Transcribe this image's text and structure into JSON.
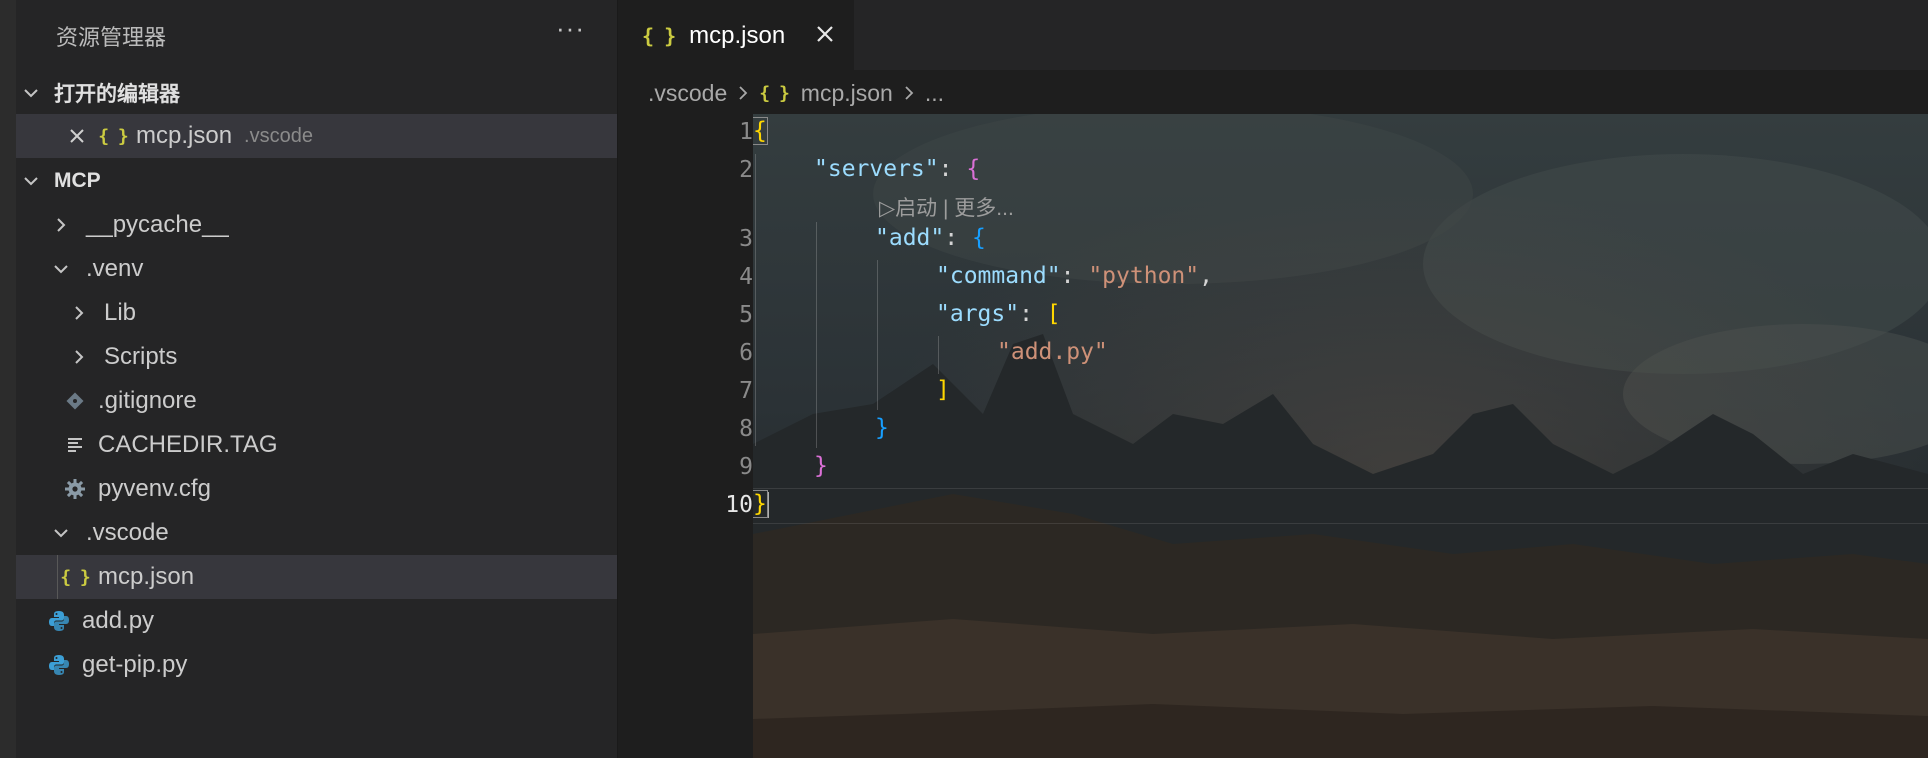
{
  "sidebar": {
    "title": "资源管理器",
    "more": "···",
    "open_editors": {
      "header": "打开的编辑器",
      "items": [
        {
          "name": "mcp.json",
          "folder": ".vscode",
          "icon": "json-icon"
        }
      ]
    },
    "workspace": {
      "header": "MCP",
      "tree": [
        {
          "label": "__pycache__",
          "type": "folder",
          "state": "collapsed"
        },
        {
          "label": ".venv",
          "type": "folder",
          "state": "expanded"
        },
        {
          "label": "Lib",
          "type": "folder",
          "state": "collapsed"
        },
        {
          "label": "Scripts",
          "type": "folder",
          "state": "collapsed"
        },
        {
          "label": ".gitignore",
          "type": "file",
          "icon": "git-icon"
        },
        {
          "label": "CACHEDIR.TAG",
          "type": "file",
          "icon": "text-file-icon"
        },
        {
          "label": "pyvenv.cfg",
          "type": "file",
          "icon": "gear-icon"
        },
        {
          "label": ".vscode",
          "type": "folder",
          "state": "expanded"
        },
        {
          "label": "mcp.json",
          "type": "file",
          "icon": "json-icon",
          "selected": true
        },
        {
          "label": "add.py",
          "type": "file",
          "icon": "python-icon"
        },
        {
          "label": "get-pip.py",
          "type": "file",
          "icon": "python-icon"
        }
      ]
    }
  },
  "tabs": [
    {
      "label": "mcp.json",
      "icon": "json-icon",
      "active": true
    }
  ],
  "breadcrumb": {
    "folder": ".vscode",
    "file": "mcp.json",
    "symbol": "..."
  },
  "editor": {
    "codelens": "▷启动 | 更多...",
    "line_numbers": [
      "1",
      "2",
      "3",
      "4",
      "5",
      "6",
      "7",
      "8",
      "9",
      "10"
    ],
    "active_line": "10",
    "lines": {
      "l1": [
        "{"
      ],
      "l2": [
        "\"servers\"",
        ": ",
        "{"
      ],
      "l3": [
        "\"add\"",
        ": ",
        "{"
      ],
      "l4": [
        "\"command\"",
        ": ",
        "\"python\"",
        ","
      ],
      "l5": [
        "\"args\"",
        ": ",
        "["
      ],
      "l6": [
        "\"add.py\""
      ],
      "l7": [
        "]"
      ],
      "l8": [
        "}"
      ],
      "l9": [
        "}"
      ],
      "l10": [
        "}"
      ]
    }
  },
  "colors": {
    "json_key": "#9cdcfe",
    "json_string": "#ce9178",
    "bracket_level1": "#ffd700",
    "bracket_level2": "#da70d6",
    "bracket_level3": "#179fff",
    "json_icon": "#cbcb41",
    "python_icon": "#3c9fd6"
  }
}
